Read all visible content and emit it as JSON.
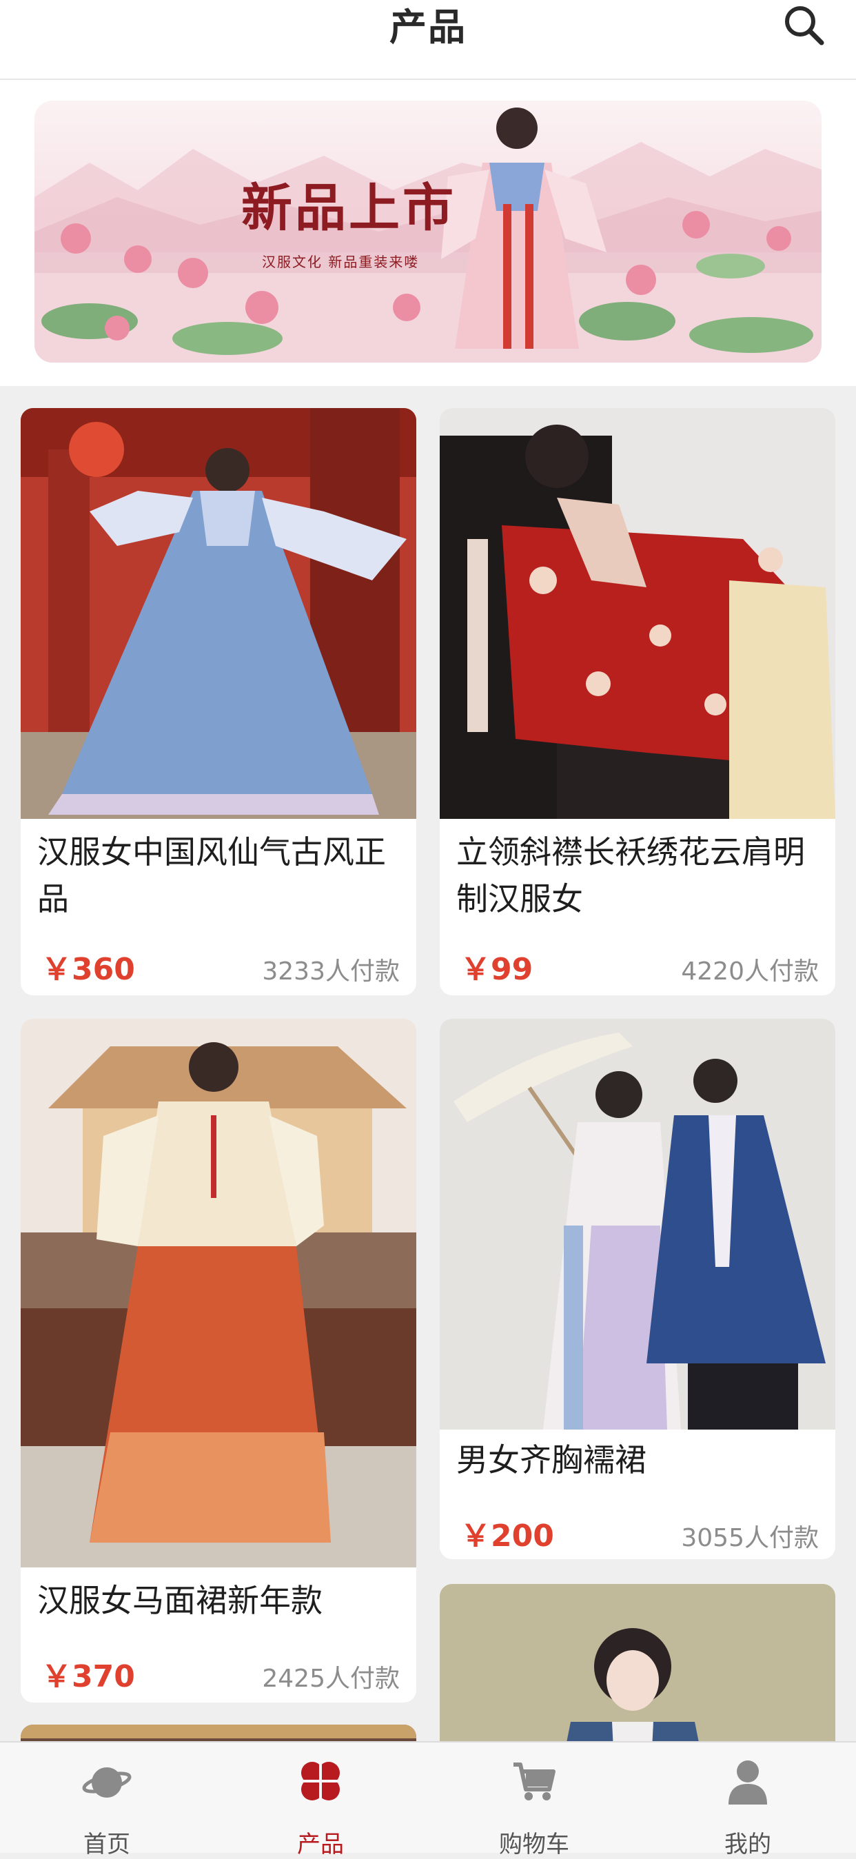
{
  "header": {
    "title": "产品",
    "search_icon": "search-icon"
  },
  "banner": {
    "title": "新品上市",
    "subtitle": "汉服文化 新品重装来喽"
  },
  "colors": {
    "accent": "#b81b1f",
    "price": "#e0412f",
    "muted": "#8c8c8c"
  },
  "products": [
    {
      "name": "汉服女中国风仙气古风正品",
      "price": "￥360",
      "sales": "3233人付款"
    },
    {
      "name": "立领斜襟长袄绣花云肩明制汉服女",
      "price": "￥99",
      "sales": "4220人付款"
    },
    {
      "name": "汉服女马面裙新年款",
      "price": "￥370",
      "sales": "2425人付款"
    },
    {
      "name": "男女齐胸襦裙",
      "price": "￥200",
      "sales": "3055人付款"
    }
  ],
  "nav": {
    "items": [
      {
        "label": "首页",
        "icon": "planet-icon",
        "active": false
      },
      {
        "label": "产品",
        "icon": "clover-icon",
        "active": true
      },
      {
        "label": "购物车",
        "icon": "cart-icon",
        "active": false
      },
      {
        "label": "我的",
        "icon": "person-icon",
        "active": false
      }
    ]
  }
}
